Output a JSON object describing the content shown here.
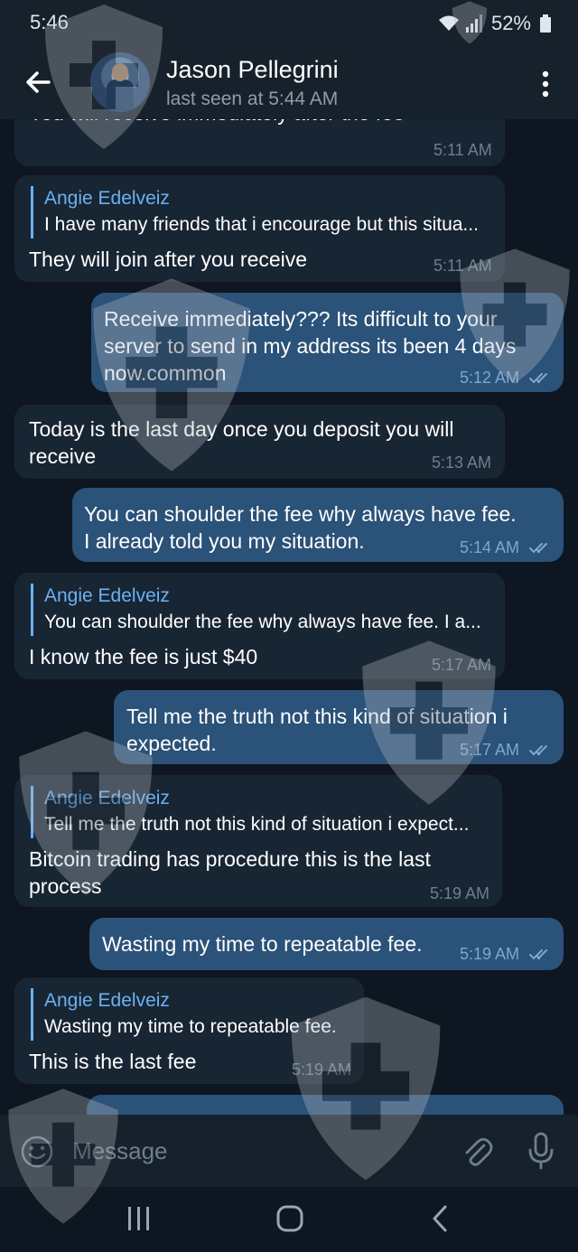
{
  "status_bar": {
    "time": "5:46",
    "battery": "52%"
  },
  "header": {
    "name": "Jason Pellegrini",
    "last_seen": "last seen at 5:44 AM"
  },
  "messages": [
    {
      "dir": "in",
      "text_lines": [
        "You will receive immediately after the fee"
      ],
      "time": "5:11 AM"
    },
    {
      "dir": "in",
      "reply_name": "Angie Edelveiz",
      "reply_text": "I have many friends that i encourage but this situa...",
      "text_lines": [
        "They will join after you receive"
      ],
      "time": "5:11 AM"
    },
    {
      "dir": "out",
      "text_lines": [
        "Receive immediately??? Its difficult to your",
        "server to send in my address its been 4 days",
        "now.common"
      ],
      "time": "5:12 AM"
    },
    {
      "dir": "in",
      "text_lines": [
        "Today is the last day once you deposit you will",
        "receive"
      ],
      "time": "5:13 AM"
    },
    {
      "dir": "out",
      "text_lines": [
        "You can shoulder the fee why always have fee.",
        "I already told you my situation."
      ],
      "time": "5:14 AM"
    },
    {
      "dir": "in",
      "reply_name": "Angie Edelveiz",
      "reply_text": "You can shoulder the fee why always have fee. I a...",
      "text_lines": [
        "I know the fee is just $40"
      ],
      "time": "5:17 AM"
    },
    {
      "dir": "out",
      "text_lines": [
        "Tell me the truth not this kind of situation i",
        "expected."
      ],
      "time": "5:17 AM"
    },
    {
      "dir": "in",
      "reply_name": "Angie Edelveiz",
      "reply_text": "Tell me the truth not this kind of situation i expect...",
      "text_lines": [
        "Bitcoin trading has procedure this is the last",
        "process"
      ],
      "time": "5:19 AM"
    },
    {
      "dir": "out",
      "text_lines": [
        "Wasting my time to repeatable fee."
      ],
      "time": "5:19 AM"
    },
    {
      "dir": "in",
      "reply_name": "Angie Edelveiz",
      "reply_text": "Wasting my time to repeatable fee.",
      "text_lines": [
        "This is the last fee"
      ],
      "time": "5:19 AM"
    }
  ],
  "input": {
    "placeholder": "Message"
  },
  "icons": {
    "back": "arrow-left-icon",
    "menu": "more-vertical-icon",
    "emoji": "emoji-icon",
    "attach": "paperclip-icon",
    "mic": "microphone-icon",
    "read": "double-check-icon"
  },
  "colors": {
    "background": "#0e1621",
    "header": "#17212b",
    "incoming_bubble": "#182533",
    "outgoing_bubble": "#2b5278",
    "accent": "#6ab2f2"
  }
}
